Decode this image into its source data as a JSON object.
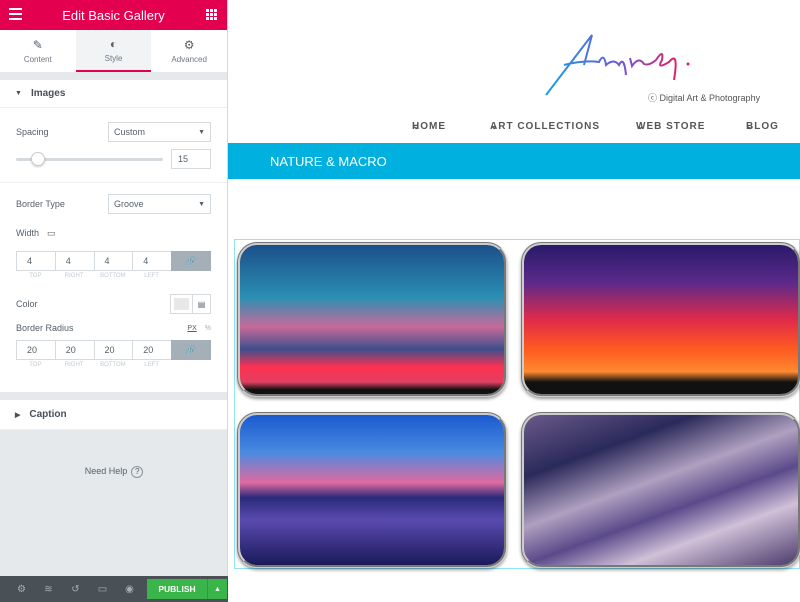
{
  "panel": {
    "title": "Edit Basic Gallery",
    "tabs": [
      {
        "label": "Content",
        "icon": "pencil-icon"
      },
      {
        "label": "Style",
        "icon": "half-circle-icon",
        "active": true
      },
      {
        "label": "Advanced",
        "icon": "gear-icon"
      }
    ],
    "images_section": "Images",
    "spacing": {
      "label": "Spacing",
      "value": "Custom",
      "slider_value": "15"
    },
    "border_type": {
      "label": "Border Type",
      "value": "Groove"
    },
    "width": {
      "label": "Width",
      "values": [
        "4",
        "4",
        "4",
        "4"
      ],
      "sides": [
        "TOP",
        "RIGHT",
        "BOTTOM",
        "LEFT"
      ]
    },
    "color": {
      "label": "Color",
      "value": "#e8e8e8"
    },
    "border_radius": {
      "label": "Border Radius",
      "units": [
        "PX",
        "%"
      ],
      "values": [
        "20",
        "20",
        "20",
        "20"
      ]
    },
    "caption_section": "Caption",
    "help": "Need Help",
    "publish": "PUBLISH",
    "accent": "#e2004f"
  },
  "site": {
    "logo_text": "AngieG.",
    "tagline": "Digital Art & Photography",
    "nav": [
      "HOME",
      "ART COLLECTIONS",
      "WEB STORE",
      "BLOG"
    ],
    "banner": "NATURE & MACRO",
    "banner_color": "#00b0de"
  }
}
